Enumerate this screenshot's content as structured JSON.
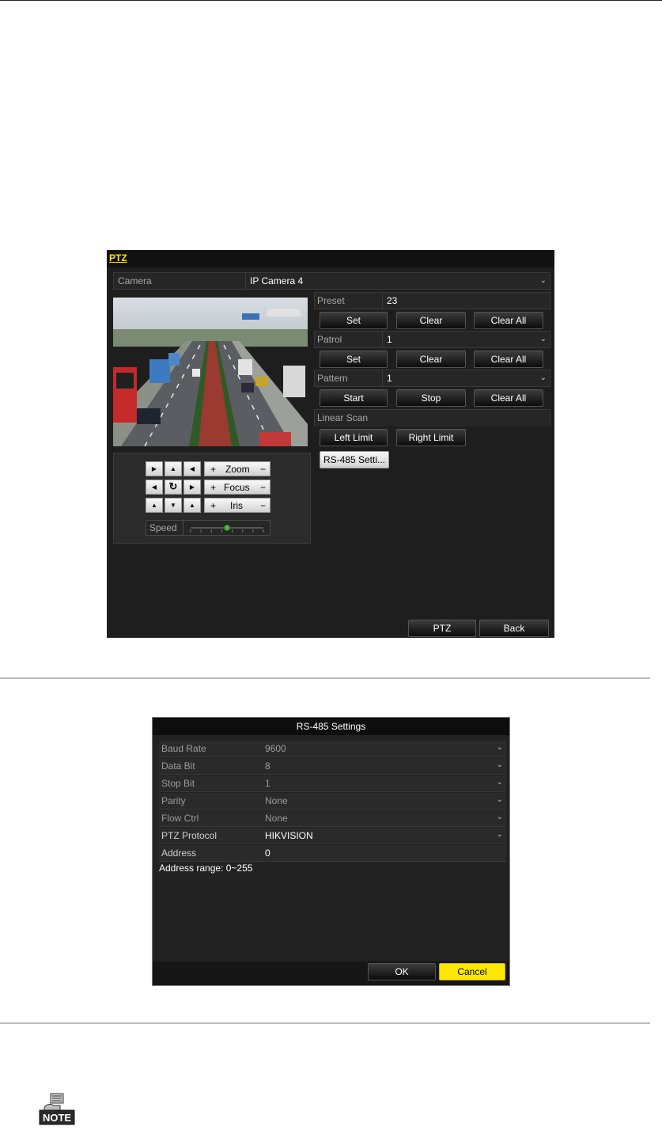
{
  "ptz_window": {
    "title": "PTZ",
    "camera_label": "Camera",
    "camera_value": "IP Camera 4",
    "preset": {
      "label": "Preset",
      "value": "23",
      "set": "Set",
      "clear": "Clear",
      "clear_all": "Clear All"
    },
    "patrol": {
      "label": "Patrol",
      "value": "1",
      "set": "Set",
      "clear": "Clear",
      "clear_all": "Clear All"
    },
    "pattern": {
      "label": "Pattern",
      "value": "1",
      "start": "Start",
      "stop": "Stop",
      "clear_all": "Clear All"
    },
    "linear_scan": {
      "label": "Linear Scan",
      "left_limit": "Left Limit",
      "right_limit": "Right Limit"
    },
    "rs485_button": "RS-485 Setti...",
    "controls": {
      "zoom": "Zoom",
      "focus": "Focus",
      "iris": "Iris",
      "plus": "+",
      "minus": "−",
      "speed_label": "Speed",
      "speed_level": 0.5
    },
    "ptz_button": "PTZ",
    "back_button": "Back"
  },
  "rs485_dialog": {
    "title": "RS-485 Settings",
    "fields": [
      {
        "label": "Baud Rate",
        "value": "9600"
      },
      {
        "label": "Data Bit",
        "value": "8"
      },
      {
        "label": "Stop Bit",
        "value": "1"
      },
      {
        "label": "Parity",
        "value": "None"
      },
      {
        "label": "Flow Ctrl",
        "value": "None"
      },
      {
        "label": "PTZ Protocol",
        "value": "HIKVISION"
      },
      {
        "label": "Address",
        "value": "0"
      }
    ],
    "hint": "Address range: 0~255",
    "ok": "OK",
    "cancel": "Cancel"
  },
  "note_icon": {
    "label": "NOTE"
  }
}
